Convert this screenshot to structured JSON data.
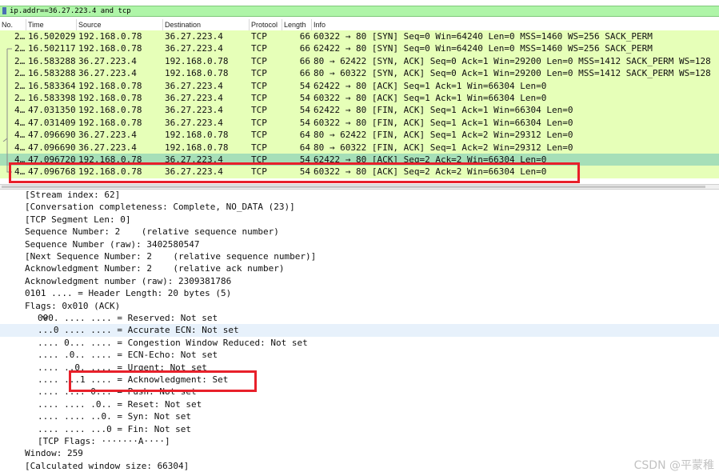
{
  "filter": {
    "value": "ip.addr==36.27.223.4 and tcp"
  },
  "columns": {
    "no": "No.",
    "time": "Time",
    "source": "Source",
    "destination": "Destination",
    "protocol": "Protocol",
    "length": "Length",
    "info": "Info"
  },
  "packets": [
    {
      "no": "2…",
      "time": "16.502029",
      "src": "192.168.0.78",
      "dst": "36.27.223.4",
      "proto": "TCP",
      "len": "66",
      "info": "60322 → 80 [SYN] Seq=0 Win=64240 Len=0 MSS=1460 WS=256 SACK_PERM"
    },
    {
      "no": "2…",
      "time": "16.502117",
      "src": "192.168.0.78",
      "dst": "36.27.223.4",
      "proto": "TCP",
      "len": "66",
      "info": "62422 → 80 [SYN] Seq=0 Win=64240 Len=0 MSS=1460 WS=256 SACK_PERM"
    },
    {
      "no": "2…",
      "time": "16.583288",
      "src": "36.27.223.4",
      "dst": "192.168.0.78",
      "proto": "TCP",
      "len": "66",
      "info": "80 → 62422 [SYN, ACK] Seq=0 Ack=1 Win=29200 Len=0 MSS=1412 SACK_PERM WS=128"
    },
    {
      "no": "2…",
      "time": "16.583288",
      "src": "36.27.223.4",
      "dst": "192.168.0.78",
      "proto": "TCP",
      "len": "66",
      "info": "80 → 60322 [SYN, ACK] Seq=0 Ack=1 Win=29200 Len=0 MSS=1412 SACK_PERM WS=128"
    },
    {
      "no": "2…",
      "time": "16.583364",
      "src": "192.168.0.78",
      "dst": "36.27.223.4",
      "proto": "TCP",
      "len": "54",
      "info": "62422 → 80 [ACK] Seq=1 Ack=1 Win=66304 Len=0"
    },
    {
      "no": "2…",
      "time": "16.583398",
      "src": "192.168.0.78",
      "dst": "36.27.223.4",
      "proto": "TCP",
      "len": "54",
      "info": "60322 → 80 [ACK] Seq=1 Ack=1 Win=66304 Len=0"
    },
    {
      "no": "4…",
      "time": "47.031350",
      "src": "192.168.0.78",
      "dst": "36.27.223.4",
      "proto": "TCP",
      "len": "54",
      "info": "62422 → 80 [FIN, ACK] Seq=1 Ack=1 Win=66304 Len=0"
    },
    {
      "no": "4…",
      "time": "47.031409",
      "src": "192.168.0.78",
      "dst": "36.27.223.4",
      "proto": "TCP",
      "len": "54",
      "info": "60322 → 80 [FIN, ACK] Seq=1 Ack=1 Win=66304 Len=0"
    },
    {
      "no": "4…",
      "time": "47.096690",
      "src": "36.27.223.4",
      "dst": "192.168.0.78",
      "proto": "TCP",
      "len": "64",
      "info": "80 → 62422 [FIN, ACK] Seq=1 Ack=2 Win=29312 Len=0"
    },
    {
      "no": "4…",
      "time": "47.096690",
      "src": "36.27.223.4",
      "dst": "192.168.0.78",
      "proto": "TCP",
      "len": "64",
      "info": "80 → 60322 [FIN, ACK] Seq=1 Ack=2 Win=29312 Len=0"
    },
    {
      "no": "4…",
      "time": "47.096720",
      "src": "192.168.0.78",
      "dst": "36.27.223.4",
      "proto": "TCP",
      "len": "54",
      "info": "62422 → 80 [ACK] Seq=2 Ack=2 Win=66304 Len=0"
    },
    {
      "no": "4…",
      "time": "47.096768",
      "src": "192.168.0.78",
      "dst": "36.27.223.4",
      "proto": "TCP",
      "len": "54",
      "info": "60322 → 80 [ACK] Seq=2 Ack=2 Win=66304 Len=0"
    }
  ],
  "details": [
    {
      "text": "[Stream index: 62]"
    },
    {
      "text": "[Conversation completeness: Complete, NO_DATA (23)]"
    },
    {
      "text": "[TCP Segment Len: 0]"
    },
    {
      "text": "Sequence Number: 2    (relative sequence number)"
    },
    {
      "text": "Sequence Number (raw): 3402580547"
    },
    {
      "text": "[Next Sequence Number: 2    (relative sequence number)]"
    },
    {
      "text": "Acknowledgment Number: 2    (relative ack number)"
    },
    {
      "text": "Acknowledgment number (raw): 2309381786"
    },
    {
      "text": "0101 .... = Header Length: 20 bytes (5)"
    },
    {
      "text": "Flags: 0x010 (ACK)"
    },
    {
      "text": "000. .... .... = Reserved: Not set"
    },
    {
      "text": "...0 .... .... = Accurate ECN: Not set"
    },
    {
      "text": ".... 0... .... = Congestion Window Reduced: Not set"
    },
    {
      "text": ".... .0.. .... = ECN-Echo: Not set"
    },
    {
      "text": ".... ..0. .... = Urgent: Not set"
    },
    {
      "text": ".... ...1 .... = Acknowledgment: Set"
    },
    {
      "text": ".... .... 0... = Push: Not set"
    },
    {
      "text": ".... .... .0.. = Reset: Not set"
    },
    {
      "text": ".... .... ..0. = Syn: Not set"
    },
    {
      "text": ".... .... ...0 = Fin: Not set"
    },
    {
      "text": "[TCP Flags: ·······A····]"
    },
    {
      "text": "Window: 259"
    },
    {
      "text": "[Calculated window size: 66304]"
    }
  ],
  "flags_expand_icon": "chevron-down-icon",
  "watermark": "CSDN @平蒙稚",
  "colors": {
    "filter_bg": "#aff5a8",
    "row_bg": "#e6ffb8",
    "selected_row_bg": "#a6dfb8",
    "highlight_border": "#e8202a",
    "detail_selected_bg": "#e7f1fb"
  }
}
